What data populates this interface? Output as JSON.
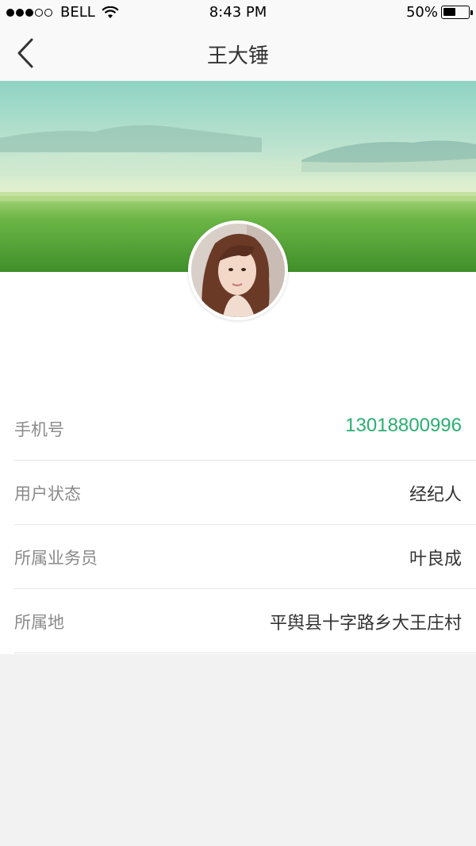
{
  "status_bar": {
    "carrier": "BELL",
    "time": "8:43 PM",
    "battery_percent": "50%",
    "battery_level": 0.5,
    "signal_bars_full": 3,
    "signal_bars_total": 5
  },
  "nav": {
    "title": "王大锤",
    "back_icon": "chevron-left-icon"
  },
  "profile": {
    "fields": [
      {
        "label": "手机号",
        "value": "13018800996"
      },
      {
        "label": "用户状态",
        "value": "经纪人"
      },
      {
        "label": "所属业务员",
        "value": "叶良成"
      },
      {
        "label": "所属地",
        "value": "平舆县十字路乡大王庄村"
      }
    ]
  },
  "colors": {
    "phone_accent": "#2aae72",
    "nav_background": "#f9f9f9",
    "page_background": "#f2f2f2"
  }
}
